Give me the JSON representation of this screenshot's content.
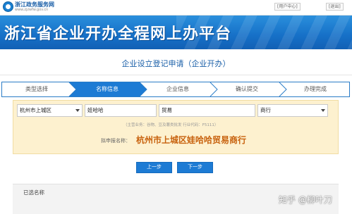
{
  "header": {
    "site_title": "浙江政务服务网",
    "site_url": "www.zjzwfw.gov.cn",
    "links": {
      "user_center": "[用户中心]",
      "logout": "[退出]"
    }
  },
  "banner": {
    "title": "浙江省企业开办全程网上办平台"
  },
  "page": {
    "heading": "企业设立登记申请（企业开办）"
  },
  "steps": [
    {
      "label": "类型选择",
      "state": "done"
    },
    {
      "label": "名称信息",
      "state": "current"
    },
    {
      "label": "企业信息",
      "state": "todo"
    },
    {
      "label": "确认提交",
      "state": "todo"
    },
    {
      "label": "办理完成",
      "state": "todo"
    }
  ],
  "form": {
    "region": "杭州市上城区",
    "trade_name": "娃哈哈",
    "industry": "贸易",
    "org_form": "商行",
    "hint": "（主营业务：谷物、豆及薯类批发    行业代码：F5111）",
    "proposed_label": "拟申报名称：",
    "proposed_name": "杭州市上城区娃哈哈贸易商行"
  },
  "buttons": {
    "prev": "上一步",
    "next": "下一步"
  },
  "selected": {
    "title": "已选名称"
  },
  "watermark": "知乎 @柳叶刀",
  "colors": {
    "primary": "#1d7bd4",
    "panel_bg": "#fdf1cf",
    "proposed_name": "#c8620e",
    "step_active": "#1d7bd4"
  }
}
